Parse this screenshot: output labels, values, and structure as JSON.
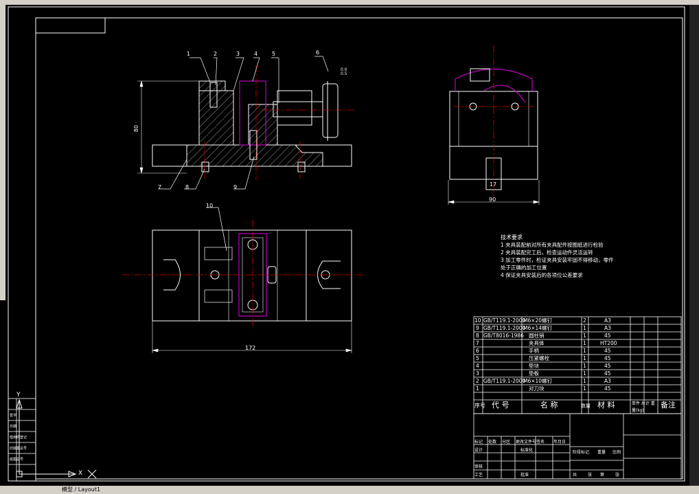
{
  "callouts": [
    "1",
    "2",
    "3",
    "4",
    "5",
    "6",
    "7",
    "8",
    "9",
    "10"
  ],
  "dims": {
    "height_front": "80",
    "width_side": "90",
    "shaft_side": "17",
    "length_top": "172",
    "small_top": "0.0",
    "small_bottom": "0.5"
  },
  "tech_notes": {
    "title": "技术要求",
    "lines": [
      "1  夹具装配前对所有夹具配件按图纸进行检验",
      "2  夹具装配完工后，检查运动件灵活运转",
      "3  加工零件时，检证夹具安装牢固不得移动，零件",
      "    处于正确的加工位置",
      "4  保证夹具安装后的各项位公差要求"
    ]
  },
  "bom": {
    "rows": [
      {
        "no": "10",
        "code": "GB/T119.1-2000",
        "name": "M6×20螺钉",
        "qty": "2",
        "mat": "A3"
      },
      {
        "no": "9",
        "code": "GB/T119.1-2000",
        "name": "M6×14螺钉",
        "qty": "1",
        "mat": "A3"
      },
      {
        "no": "8",
        "code": "GB/T8016-1986",
        "name": "圆柱销",
        "qty": "1",
        "mat": "45"
      },
      {
        "no": "7",
        "code": "",
        "name": "夹具体",
        "qty": "1",
        "mat": "HT200"
      },
      {
        "no": "6",
        "code": "",
        "name": "手柄",
        "qty": "1",
        "mat": "45"
      },
      {
        "no": "5",
        "code": "",
        "name": "压紧螺栓",
        "qty": "1",
        "mat": "45"
      },
      {
        "no": "4",
        "code": "",
        "name": "垫块",
        "qty": "1",
        "mat": "45"
      },
      {
        "no": "3",
        "code": "",
        "name": "垫板",
        "qty": "1",
        "mat": "45"
      },
      {
        "no": "2",
        "code": "GB/T119.1-2000",
        "name": "M6×10螺钉",
        "qty": "1",
        "mat": "A3"
      },
      {
        "no": "1",
        "code": "",
        "name": "对刀块",
        "qty": "1",
        "mat": "45"
      }
    ],
    "header": {
      "no": "序号",
      "code": "代  号",
      "name": "名  称",
      "qty": "数量",
      "mat": "材  料",
      "weight": "单件 总计 重量(kg)",
      "note": "备注"
    }
  },
  "title_block": {
    "r1": [
      "标记",
      "处数",
      "分区",
      "更改文件号",
      "签名",
      "年月日"
    ],
    "r2": [
      "设计",
      "标准化"
    ],
    "r3": [
      "审核"
    ],
    "r4": [
      "工艺",
      "批准"
    ],
    "mid": [
      "阶段标记",
      "重量",
      "比例"
    ],
    "bottom": [
      "共",
      "张",
      "第",
      "张"
    ]
  },
  "ucs": {
    "x": "X",
    "y": "Y"
  },
  "left_strip": [
    "借用件登记",
    "旧底图总号",
    "底图总号",
    "签字",
    "日期"
  ],
  "status_text": "模型 / Layout1"
}
